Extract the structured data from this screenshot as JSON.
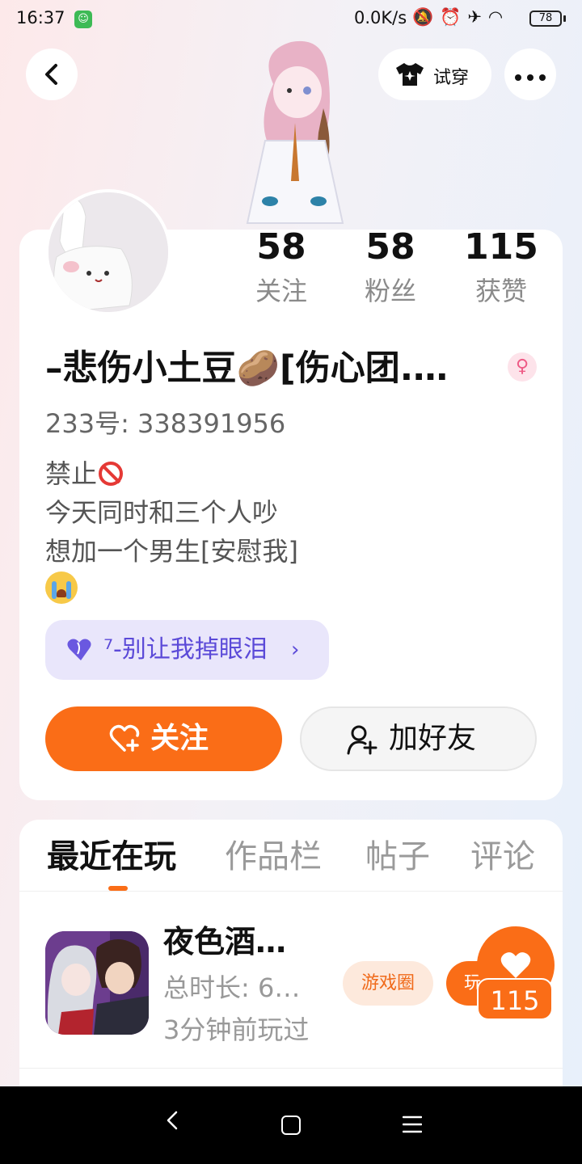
{
  "status_bar": {
    "time": "16:37",
    "network_speed": "0.0K/s",
    "battery": "78",
    "icons": [
      "bell-off-icon",
      "alarm-icon",
      "airplane-icon",
      "wifi-icon",
      "battery-icon"
    ]
  },
  "header": {
    "try_on_label": "试穿"
  },
  "profile": {
    "stats": [
      {
        "value": "58",
        "label": "关注"
      },
      {
        "value": "58",
        "label": "粉丝"
      },
      {
        "value": "115",
        "label": "获赞"
      }
    ],
    "nickname": "–悲伤小土豆🥔[伤心团.…",
    "gender_symbol": "♀",
    "user_id": "233号: 338391956",
    "bio_line1": "禁止",
    "bio_line2": "今天同时和三个人吵",
    "bio_line3": "想加一个男生[安慰我]",
    "group_label": "⁷-别让我掉眼泪",
    "follow_label": "关注",
    "add_friend_label": "加好友"
  },
  "tabs": [
    {
      "label": "最近在玩",
      "active": true
    },
    {
      "label": "作品栏",
      "active": false
    },
    {
      "label": "帖子",
      "active": false
    },
    {
      "label": "评论",
      "active": false
    }
  ],
  "recent_game": {
    "title": "夜色酒…",
    "duration": "总时长: 6…",
    "last_played": "3分钟前玩过",
    "circle_tag": "游戏圈",
    "play_tag": "玩",
    "like_count": "115"
  },
  "colors": {
    "accent": "#fa6d17",
    "group_pill_bg": "#e9e6fb",
    "group_pill_text": "#5b4ad8"
  }
}
